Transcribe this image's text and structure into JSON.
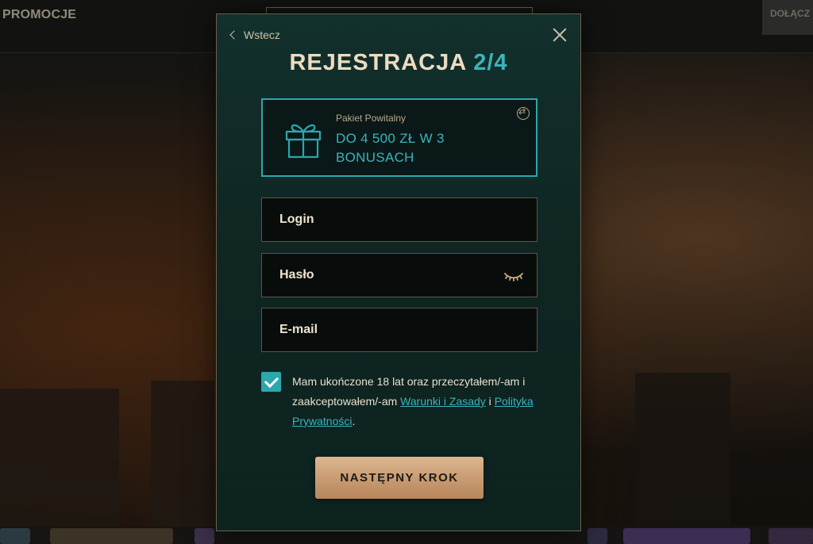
{
  "nav": {
    "promocje": "PROMOCJE",
    "join": "DOŁĄCZ"
  },
  "modal": {
    "back_label": "Wstecz",
    "title": "REJESTRACJA",
    "step": "2/4",
    "bonus": {
      "subtitle": "Pakiet Powitalny",
      "text": "DO 4 500 ZŁ W 3 BONUSACH"
    },
    "fields": {
      "login_placeholder": "Login",
      "password_placeholder": "Hasło",
      "email_placeholder": "E-mail"
    },
    "consent": {
      "checked": true,
      "text_before": "Mam ukończone 18 lat oraz przeczytałem/-am i zaakceptowałem/-am ",
      "terms_link": "Warunki i Zasady",
      "text_middle": " i ",
      "privacy_link": "Polityka Prywatności",
      "text_after": "."
    },
    "next_button": "NASTĘPNY KROK"
  },
  "colors": {
    "accent": "#3ab4bd",
    "gold": "#c79a70",
    "modal_bg": "#12302c"
  },
  "icons": [
    "chevron-left-icon",
    "close-icon",
    "gift-icon",
    "swap-icon",
    "eye-closed-icon",
    "checkmark-icon"
  ]
}
